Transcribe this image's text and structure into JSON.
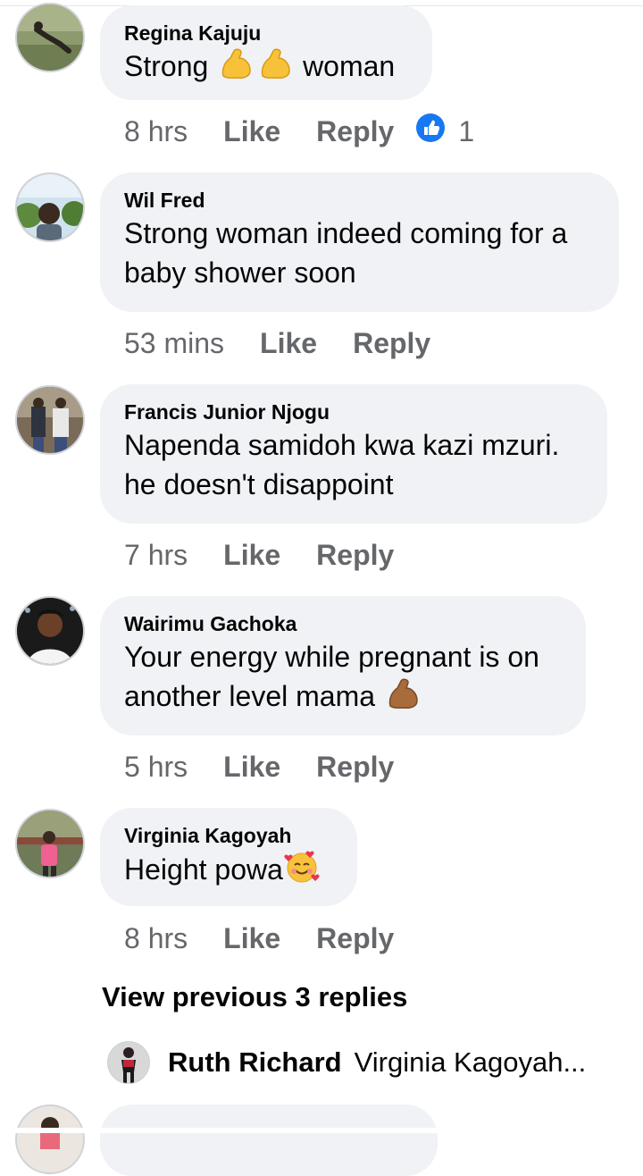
{
  "comments": [
    {
      "author": "Regina Kajuju",
      "text_before": "Strong ",
      "emoji": "flexed-biceps-icon x2",
      "text_after": " woman",
      "time": "8 hrs",
      "like_label": "Like",
      "reply_label": "Reply",
      "reaction_count": "1"
    },
    {
      "author": "Wil Fred",
      "line1": "Strong woman indeed coming for a",
      "line2": "baby shower soon",
      "time": "53 mins",
      "like_label": "Like",
      "reply_label": "Reply"
    },
    {
      "author": "Francis Junior Njogu",
      "line1": "Napenda samidoh kwa kazi mzuri.",
      "line2": "he doesn't disappoint",
      "time": "7 hrs",
      "like_label": "Like",
      "reply_label": "Reply"
    },
    {
      "author": "Wairimu Gachoka",
      "line1": "Your energy while pregnant is on",
      "line2": "another level mama ",
      "emoji": "flexed-biceps-icon",
      "time": "5 hrs",
      "like_label": "Like",
      "reply_label": "Reply"
    },
    {
      "author": "Virginia Kagoyah",
      "text": "Height powa",
      "emoji": "smiling-face-with-hearts-icon",
      "time": "8 hrs",
      "like_label": "Like",
      "reply_label": "Reply"
    }
  ],
  "view_previous": "View previous 3 replies",
  "reply_preview": {
    "author": "Ruth Richard",
    "text": "Virginia Kagoyah..."
  },
  "colors": {
    "bubble": "#f0f2f5",
    "secondary_text": "#65676b",
    "like_blue": "#1877f2"
  }
}
